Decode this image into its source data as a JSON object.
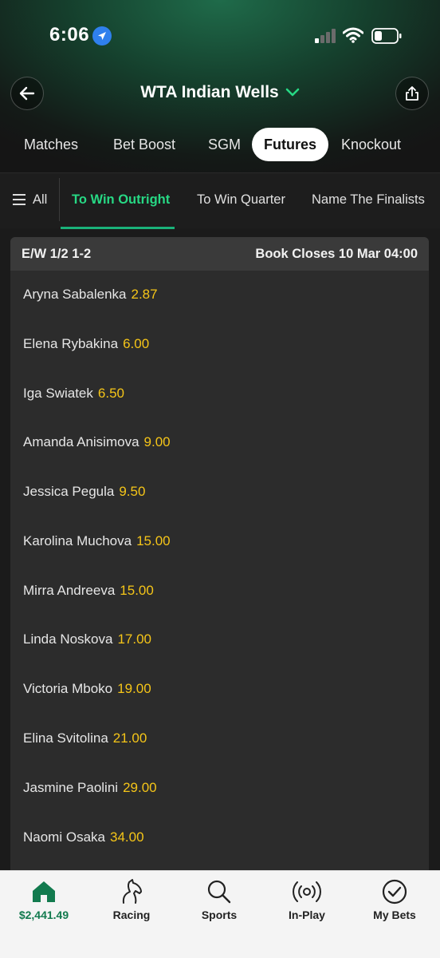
{
  "status_bar": {
    "time": "6:06"
  },
  "header": {
    "title": "WTA Indian Wells"
  },
  "tabs": [
    {
      "label": "Matches"
    },
    {
      "label": "Bet Boost"
    },
    {
      "label": "SGM"
    },
    {
      "label": "Futures",
      "active": true
    },
    {
      "label": "Knockout"
    }
  ],
  "subnav": {
    "all_label": "All",
    "items": [
      {
        "label": "To Win Outright",
        "active": true
      },
      {
        "label": "To Win Quarter"
      },
      {
        "label": "Name The Finalists"
      }
    ]
  },
  "market": {
    "terms": "E/W 1/2 1-2",
    "book_closes": "Book Closes 10 Mar 04:00",
    "runners": [
      {
        "name": "Aryna Sabalenka",
        "odds": "2.87"
      },
      {
        "name": "Elena Rybakina",
        "odds": "6.00"
      },
      {
        "name": "Iga Swiatek",
        "odds": "6.50"
      },
      {
        "name": "Amanda Anisimova",
        "odds": "9.00"
      },
      {
        "name": "Jessica Pegula",
        "odds": "9.50"
      },
      {
        "name": "Karolina Muchova",
        "odds": "15.00"
      },
      {
        "name": "Mirra Andreeva",
        "odds": "15.00"
      },
      {
        "name": "Linda Noskova",
        "odds": "17.00"
      },
      {
        "name": "Victoria Mboko",
        "odds": "19.00"
      },
      {
        "name": "Elina Svitolina",
        "odds": "21.00"
      },
      {
        "name": "Jasmine Paolini",
        "odds": "29.00"
      },
      {
        "name": "Naomi Osaka",
        "odds": "34.00"
      }
    ]
  },
  "bottom_nav": [
    {
      "label": "$2,441.49",
      "icon": "home-icon"
    },
    {
      "label": "Racing",
      "icon": "horse-icon"
    },
    {
      "label": "Sports",
      "icon": "search-icon"
    },
    {
      "label": "In-Play",
      "icon": "live-icon"
    },
    {
      "label": "My Bets",
      "icon": "checkmark-icon"
    }
  ],
  "colors": {
    "accent_green": "#27d884",
    "odds_yellow": "#f5c518",
    "home_green": "#127a4e"
  }
}
